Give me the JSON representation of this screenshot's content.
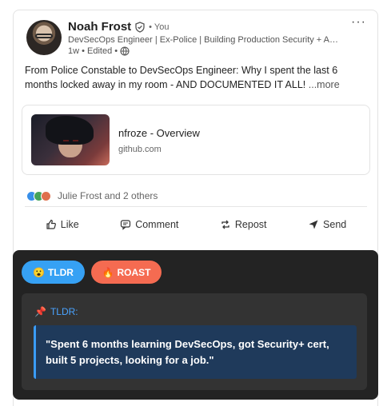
{
  "post": {
    "author_name": "Noah Frost",
    "you_tag": "• You",
    "headline": "DevSecOps Engineer | Ex-Police | Building Production Security + AI A...",
    "meta": "1w • Edited •",
    "text": "From Police Constable to DevSecOps Engineer: Why I spent the last 6 months locked away in my room - AND DOCUMENTED IT ALL!",
    "see_more": "...more",
    "more_menu": "···",
    "icons": [
      "verified-icon",
      "globe-icon"
    ]
  },
  "link_preview": {
    "title": "nfroze - Overview",
    "domain": "github.com"
  },
  "reactions": {
    "summary": "Julie Frost and 2 others",
    "types": [
      "like",
      "celebrate",
      "love"
    ]
  },
  "actions": {
    "like": "Like",
    "comment": "Comment",
    "repost": "Repost",
    "send": "Send"
  },
  "panel": {
    "tldr_button": "TLDR",
    "tldr_emoji": "😮",
    "roast_button": "ROAST",
    "roast_emoji": "🔥",
    "tldr_header": "TLDR:",
    "pin_emoji": "📌",
    "tldr_text": "\"Spent 6 months learning DevSecOps, got Security+ cert, built 5 projects, looking for a job.\"",
    "colors": {
      "tldr": "#36a1f4",
      "roast": "#f56b51",
      "panel_bg": "#232323",
      "quote_bg": "#1f3a5b"
    }
  }
}
